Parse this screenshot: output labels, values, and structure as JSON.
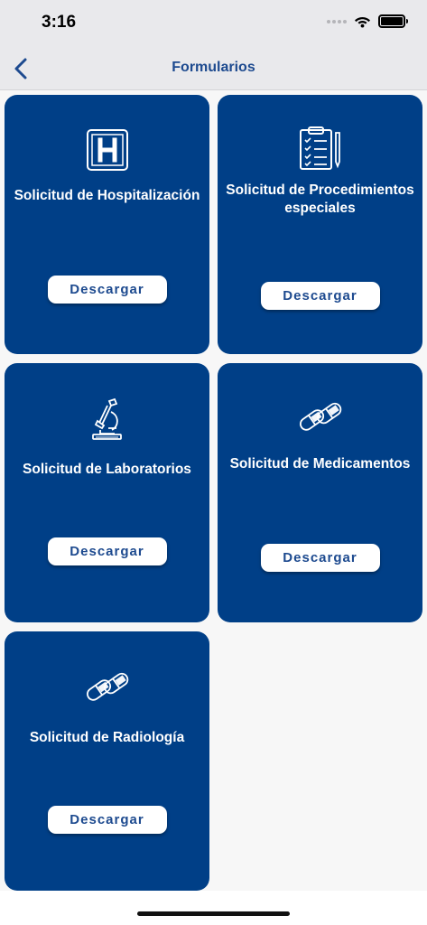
{
  "status_bar": {
    "time": "3:16"
  },
  "nav": {
    "title": "Formularios"
  },
  "cards": [
    {
      "title": "Solicitud de Hospitalización",
      "button": "Descargar",
      "icon": "hospital-icon"
    },
    {
      "title": "Solicitud de Procedimientos especiales",
      "button": "Descargar",
      "icon": "clipboard-checklist-icon"
    },
    {
      "title": "Solicitud de Laboratorios",
      "button": "Descargar",
      "icon": "microscope-icon"
    },
    {
      "title": "Solicitud de Medicamentos",
      "button": "Descargar",
      "icon": "pills-icon"
    },
    {
      "title": "Solicitud de Radiología",
      "button": "Descargar",
      "icon": "pills-icon"
    }
  ],
  "colors": {
    "card_bg": "#003f87",
    "accent": "#1d4a8f",
    "nav_bg": "#e9e9ec",
    "page_bg": "#f7f7f7"
  }
}
